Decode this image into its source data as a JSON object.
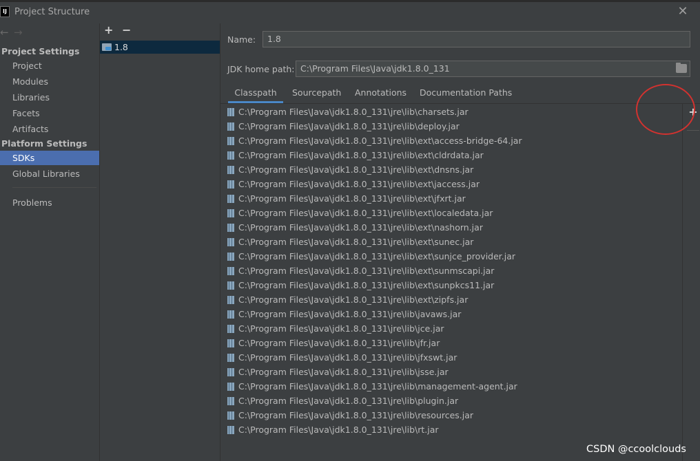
{
  "window": {
    "title": "Project Structure",
    "app_icon": "intellij-icon",
    "close_glyph": "✕"
  },
  "navigation": {
    "back_glyph": "←",
    "forward_glyph": "→"
  },
  "sidebar": {
    "project_settings_header": "Project Settings",
    "project_items": [
      "Project",
      "Modules",
      "Libraries",
      "Facets",
      "Artifacts"
    ],
    "platform_settings_header": "Platform Settings",
    "platform_items": [
      "SDKs",
      "Global Libraries"
    ],
    "selected": "SDKs",
    "problems": "Problems"
  },
  "sdk_list": {
    "add_glyph": "+",
    "remove_glyph": "−",
    "items": [
      "1.8"
    ]
  },
  "form": {
    "name_label": "Name:",
    "name_value": "1.8",
    "jdk_home_label": "JDK home path:",
    "jdk_home_value": "C:\\Program Files\\Java\\jdk1.8.0_131"
  },
  "tabs": {
    "items": [
      "Classpath",
      "Sourcepath",
      "Annotations",
      "Documentation Paths"
    ],
    "active": "Classpath"
  },
  "classpath": {
    "add_glyph": "+",
    "entries": [
      "C:\\Program Files\\Java\\jdk1.8.0_131\\jre\\lib\\charsets.jar",
      "C:\\Program Files\\Java\\jdk1.8.0_131\\jre\\lib\\deploy.jar",
      "C:\\Program Files\\Java\\jdk1.8.0_131\\jre\\lib\\ext\\access-bridge-64.jar",
      "C:\\Program Files\\Java\\jdk1.8.0_131\\jre\\lib\\ext\\cldrdata.jar",
      "C:\\Program Files\\Java\\jdk1.8.0_131\\jre\\lib\\ext\\dnsns.jar",
      "C:\\Program Files\\Java\\jdk1.8.0_131\\jre\\lib\\ext\\jaccess.jar",
      "C:\\Program Files\\Java\\jdk1.8.0_131\\jre\\lib\\ext\\jfxrt.jar",
      "C:\\Program Files\\Java\\jdk1.8.0_131\\jre\\lib\\ext\\localedata.jar",
      "C:\\Program Files\\Java\\jdk1.8.0_131\\jre\\lib\\ext\\nashorn.jar",
      "C:\\Program Files\\Java\\jdk1.8.0_131\\jre\\lib\\ext\\sunec.jar",
      "C:\\Program Files\\Java\\jdk1.8.0_131\\jre\\lib\\ext\\sunjce_provider.jar",
      "C:\\Program Files\\Java\\jdk1.8.0_131\\jre\\lib\\ext\\sunmscapi.jar",
      "C:\\Program Files\\Java\\jdk1.8.0_131\\jre\\lib\\ext\\sunpkcs11.jar",
      "C:\\Program Files\\Java\\jdk1.8.0_131\\jre\\lib\\ext\\zipfs.jar",
      "C:\\Program Files\\Java\\jdk1.8.0_131\\jre\\lib\\javaws.jar",
      "C:\\Program Files\\Java\\jdk1.8.0_131\\jre\\lib\\jce.jar",
      "C:\\Program Files\\Java\\jdk1.8.0_131\\jre\\lib\\jfr.jar",
      "C:\\Program Files\\Java\\jdk1.8.0_131\\jre\\lib\\jfxswt.jar",
      "C:\\Program Files\\Java\\jdk1.8.0_131\\jre\\lib\\jsse.jar",
      "C:\\Program Files\\Java\\jdk1.8.0_131\\jre\\lib\\management-agent.jar",
      "C:\\Program Files\\Java\\jdk1.8.0_131\\jre\\lib\\plugin.jar",
      "C:\\Program Files\\Java\\jdk1.8.0_131\\jre\\lib\\resources.jar",
      "C:\\Program Files\\Java\\jdk1.8.0_131\\jre\\lib\\rt.jar"
    ]
  },
  "annotation": {
    "highlight_color": "#d3322f",
    "highlights": "classpath-add-button"
  },
  "watermark": {
    "text": "CSDN @ccoolclouds"
  },
  "colors": {
    "background": "#3c3f41",
    "selection": "#4b6eaf",
    "list_selection": "#0d293e",
    "tab_underline": "#4a88c7",
    "text": "#bbbbbb"
  }
}
